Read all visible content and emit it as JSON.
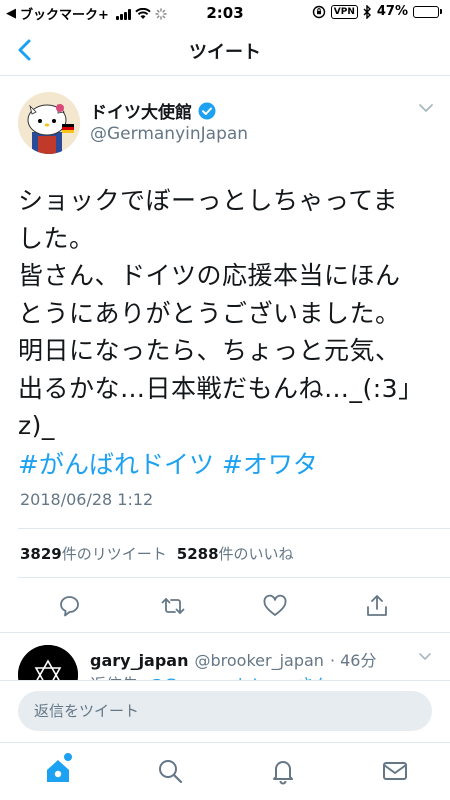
{
  "status_bar": {
    "back_app": "ブックマーク+",
    "time": "2:03",
    "vpn": "VPN",
    "battery": "47%",
    "battery_level": 0.47
  },
  "nav": {
    "title": "ツイート"
  },
  "tweet": {
    "author_name": "ドイツ大使館",
    "author_handle": "@GermanyinJapan",
    "text_lines": [
      "ショックでぼーっとしちゃってま",
      "した。",
      "皆さん、ドイツの応援本当にほん",
      "とうにありがとうございました。",
      "明日になったら、ちょっと元気、",
      "出るかな…日本戦だもんね…_(:3」",
      "z)_"
    ],
    "hashtags": [
      "#がんばれドイツ",
      "#オワタ"
    ],
    "timestamp": "2018/06/28 1:12",
    "retweet_count": "3829",
    "retweet_label": "件のリツイート",
    "like_count": "5288",
    "like_label": "件のいいね"
  },
  "reply": {
    "name": "gary_japan",
    "handle": "@brooker_japan",
    "time": "· 46分",
    "reply_prefix": "返信先:",
    "reply_mention": "@GermanyinJapanさん"
  },
  "compose": {
    "placeholder": "返信をツイート"
  },
  "colors": {
    "accent": "#1da1f2",
    "secondary_text": "#657786",
    "border": "#e1e8ed",
    "battery": "#f5c518"
  },
  "icons": {
    "nav_back": "chevron-left-icon",
    "verified": "verified-badge-icon",
    "reply": "reply-icon",
    "retweet": "retweet-icon",
    "like": "heart-icon",
    "share": "share-icon",
    "home": "home-icon",
    "search": "search-icon",
    "notifications": "bell-icon",
    "messages": "mail-icon"
  }
}
